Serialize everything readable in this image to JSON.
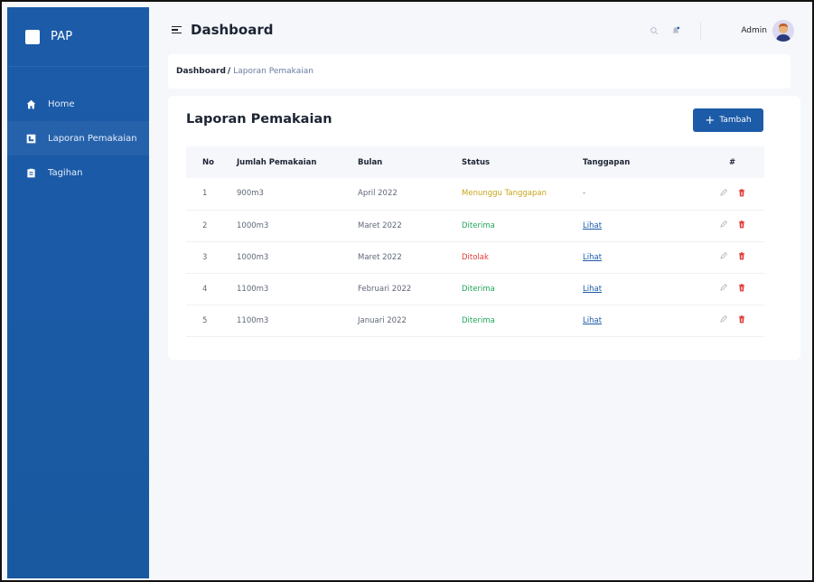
{
  "app": {
    "brand": "PAP",
    "page_title": "Dashboard"
  },
  "sidebar": {
    "items": [
      {
        "label": "Home",
        "icon": "home-icon"
      },
      {
        "label": "Laporan Pemakaian",
        "icon": "monitor-icon",
        "active": true
      },
      {
        "label": "Tagihan",
        "icon": "clipboard-icon"
      }
    ]
  },
  "topbar": {
    "user_name": "Admin"
  },
  "breadcrumb": {
    "root": "Dashboard",
    "separator": "/",
    "current": "Laporan Pemakaian"
  },
  "card": {
    "title": "Laporan Pemakaian",
    "add_label": "Tambah"
  },
  "table": {
    "headers": [
      "No",
      "Jumlah Pemakaian",
      "Bulan",
      "Status",
      "Tanggapan",
      "#"
    ],
    "rows": [
      {
        "no": "1",
        "jumlah": "900m3",
        "bulan": "April 2022",
        "status": "Menunggu Tanggapan",
        "status_type": "warning",
        "tanggapan": "-"
      },
      {
        "no": "2",
        "jumlah": "1000m3",
        "bulan": "Maret 2022",
        "status": "Diterima",
        "status_type": "success",
        "tanggapan": "Lihat"
      },
      {
        "no": "3",
        "jumlah": "1000m3",
        "bulan": "Maret 2022",
        "status": "Ditolak",
        "status_type": "danger",
        "tanggapan": "Lihat"
      },
      {
        "no": "4",
        "jumlah": "1100m3",
        "bulan": "Februari 2022",
        "status": "Diterima",
        "status_type": "success",
        "tanggapan": "Lihat"
      },
      {
        "no": "5",
        "jumlah": "1100m3",
        "bulan": "Januari 2022",
        "status": "Diterima",
        "status_type": "success",
        "tanggapan": "Lihat"
      }
    ]
  },
  "colors": {
    "primary": "#1c5ba8",
    "warning": "#c7a41a",
    "success": "#20a65a",
    "danger": "#e23b3b"
  }
}
